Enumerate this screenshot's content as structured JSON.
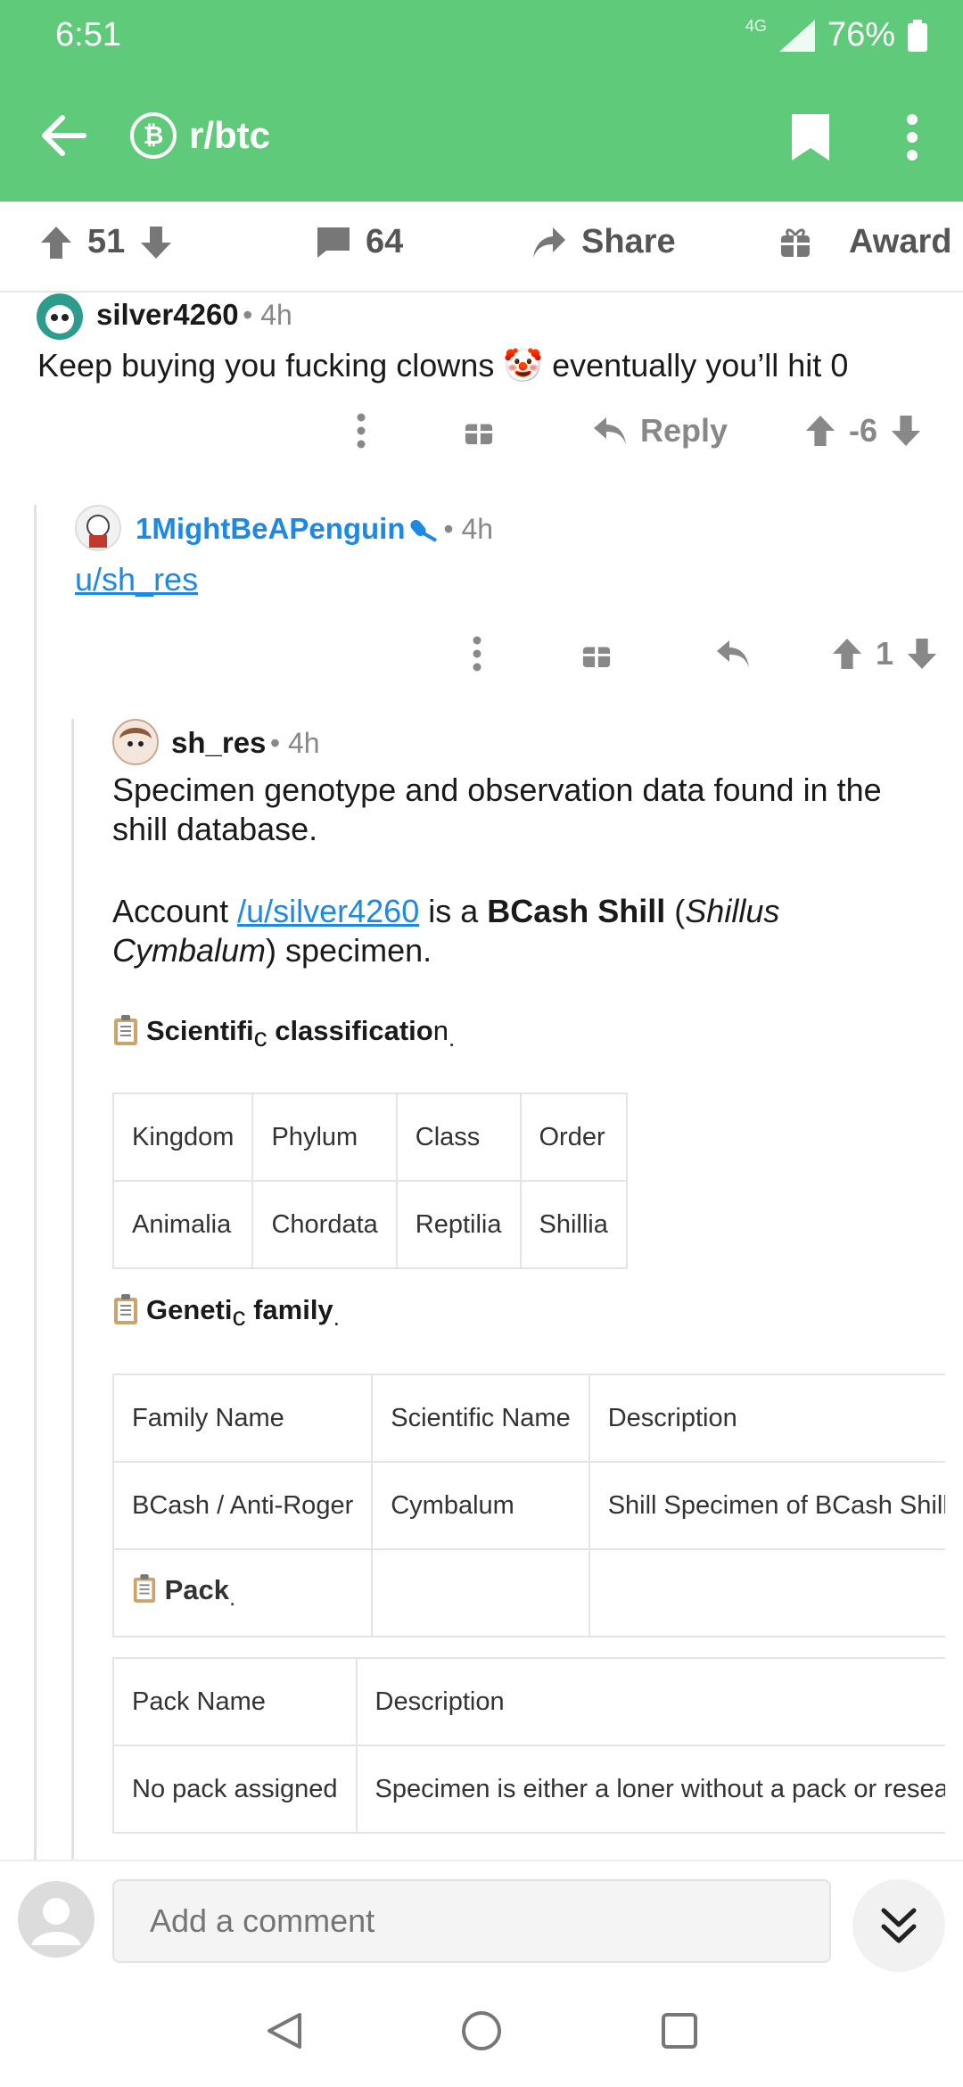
{
  "status": {
    "time": "6:51",
    "network": "4G",
    "battery": "76%"
  },
  "header": {
    "subreddit": "r/btc",
    "sub_icon": "₿"
  },
  "actions": {
    "upvotes": "51",
    "comments": "64",
    "share": "Share",
    "award": "Award"
  },
  "comment1": {
    "user": "silver4260",
    "time": "4h",
    "text": "Keep buying you fucking clowns 🤡 eventually you’ll hit 0",
    "reply": "Reply",
    "score": "-6"
  },
  "comment2": {
    "user": "1MightBeAPenguin",
    "time": "4h",
    "text": "u/sh_res",
    "score": "1"
  },
  "comment3": {
    "user": "sh_res",
    "time": "4h",
    "para1": "Specimen genotype and observation data found in the shill database.",
    "para2_a": "Account ",
    "para2_link": "/u/silver4260",
    "para2_b": " is a ",
    "para2_bold": "BCash Shill",
    "para2_c": " (",
    "para2_italic": "Shillus Cymbalum",
    "para2_d": ") specimen.",
    "heading1_a": "Scientifi",
    "heading1_sub": "c",
    "heading1_b": " classificatio",
    "heading1_c": "n",
    "heading1_d": ".",
    "table1": {
      "headers": [
        "Kingdom",
        "Phylum",
        "Class",
        "Order"
      ],
      "row": [
        "Animalia",
        "Chordata",
        "Reptilia",
        "Shillia"
      ]
    },
    "heading2_a": "Geneti",
    "heading2_sub": "c",
    "heading2_b": " family",
    "heading2_c": ".",
    "table2": {
      "headers": [
        "Family Name",
        "Scientific Name",
        "Description"
      ],
      "row": [
        "BCash / Anti-Roger",
        "Cymbalum",
        "Shill Specimen of BCash Shill"
      ],
      "pack_label": "Pack",
      "pack_dot": "."
    },
    "table3": {
      "headers": [
        "Pack Name",
        "Description"
      ],
      "row": [
        "No pack assigned",
        "Specimen is either a loner without a pack or researching"
      ]
    }
  },
  "composer": {
    "placeholder": "Add a comment"
  },
  "colors": {
    "brand": "#5fca79",
    "link": "#1e88e5",
    "clown": "#e53935"
  },
  "icons": [
    "back-arrow-icon",
    "bitcoin-icon",
    "bookmark-icon",
    "more-vert-icon",
    "upvote-icon",
    "downvote-icon",
    "comment-icon",
    "share-icon",
    "gift-icon",
    "reply-icon",
    "mic-icon",
    "clipboard-icon",
    "avatar-icon",
    "double-chevron-down-icon",
    "nav-back-icon",
    "nav-home-icon",
    "nav-recents-icon"
  ]
}
